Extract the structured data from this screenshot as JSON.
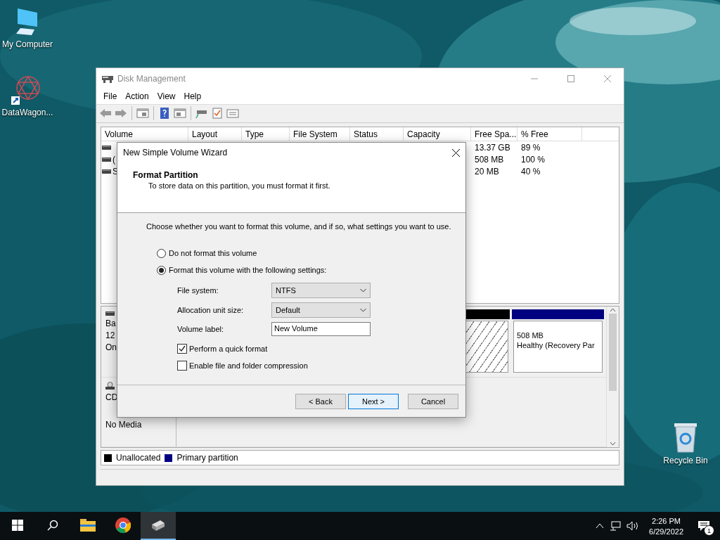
{
  "desktop": {
    "icons": [
      {
        "kind": "computer",
        "label": "My Computer"
      },
      {
        "kind": "shortcut",
        "label": "DataWagon..."
      },
      {
        "kind": "recycle",
        "label": "Recycle Bin"
      }
    ]
  },
  "window": {
    "title": "Disk Management",
    "menu": [
      "File",
      "Action",
      "View",
      "Help"
    ],
    "volume_table": {
      "columns": [
        "Volume",
        "Layout",
        "Type",
        "File System",
        "Status",
        "Capacity",
        "Free Spa...",
        "% Free"
      ],
      "rows": [
        {
          "free_space": "13.37 GB",
          "percent_free": "89 %"
        },
        {
          "volume": "(",
          "free_space": "508 MB",
          "percent_free": "100 %"
        },
        {
          "volume": "S",
          "free_space": "20 MB",
          "percent_free": "40 %"
        }
      ]
    },
    "disks": [
      {
        "kind": "basic",
        "label_lines": [
          "Ba",
          "12",
          "On"
        ],
        "partitions": [
          {
            "kind": "unallocated"
          },
          {
            "kind": "primary",
            "lines": [
              "508 MB",
              "Healthy (Recovery Par"
            ]
          }
        ]
      },
      {
        "kind": "cdrom",
        "label_lines": [
          "CD",
          "No Media"
        ]
      }
    ],
    "legend": [
      {
        "label": "Unallocated",
        "color": "#000000"
      },
      {
        "label": "Primary partition",
        "color": "#000080"
      }
    ]
  },
  "dialog": {
    "title": "New Simple Volume Wizard",
    "heading": "Format Partition",
    "subtitle": "To store data on this partition, you must format it first.",
    "instruction": "Choose whether you want to format this volume, and if so, what settings you want to use.",
    "options": [
      {
        "label": "Do not format this volume",
        "selected": false
      },
      {
        "label": "Format this volume with the following settings:",
        "selected": true
      }
    ],
    "fields": [
      {
        "kind": "select",
        "label": "File system:",
        "value": "NTFS"
      },
      {
        "kind": "select",
        "label": "Allocation unit size:",
        "value": "Default"
      },
      {
        "kind": "text",
        "label": "Volume label:",
        "value": "New Volume"
      }
    ],
    "checkboxes": [
      {
        "label": "Perform a quick format",
        "checked": true
      },
      {
        "label": "Enable file and folder compression",
        "checked": false
      }
    ],
    "buttons": [
      {
        "label": "< Back",
        "default": false
      },
      {
        "label": "Next >",
        "default": true
      },
      {
        "label": "Cancel",
        "default": false
      }
    ]
  },
  "taskbar": {
    "apps": [
      {
        "kind": "search",
        "selected": false
      },
      {
        "kind": "explorer",
        "selected": false
      },
      {
        "kind": "chrome",
        "selected": false
      },
      {
        "kind": "diskmgmt",
        "selected": true
      }
    ],
    "time": "2:26 PM",
    "date": "6/29/2022",
    "notifications": "1"
  }
}
